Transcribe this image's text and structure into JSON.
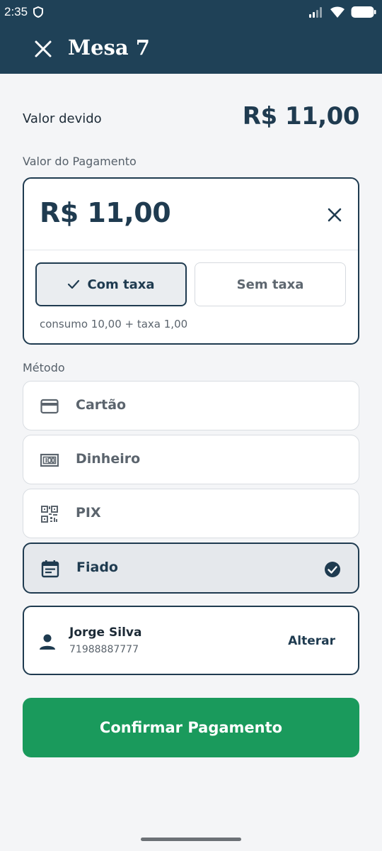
{
  "status_bar": {
    "time": "2:35"
  },
  "header": {
    "title": "Mesa 7"
  },
  "due": {
    "label": "Valor devido",
    "value": "R$ 11,00"
  },
  "payment": {
    "section_label": "Valor do Pagamento",
    "amount": "R$ 11,00",
    "options": [
      {
        "label": "Com taxa",
        "selected": true
      },
      {
        "label": "Sem taxa",
        "selected": false
      }
    ],
    "breakdown": "consumo 10,00 + taxa 1,00"
  },
  "methods": {
    "section_label": "Método",
    "items": [
      {
        "label": "Cartão",
        "icon": "credit-card-icon",
        "selected": false
      },
      {
        "label": "Dinheiro",
        "icon": "cash-icon",
        "selected": false
      },
      {
        "label": "PIX",
        "icon": "qr-code-icon",
        "selected": false
      },
      {
        "label": "Fiado",
        "icon": "calendar-icon",
        "selected": true
      }
    ]
  },
  "client": {
    "name": "Jorge Silva",
    "phone": "71988887777",
    "change_label": "Alterar"
  },
  "confirm_label": "Confirmar Pagamento",
  "colors": {
    "primary": "#1f3b50",
    "header_bg": "#1f4157",
    "confirm": "#1a9a5c",
    "background": "#f4f5f7"
  }
}
